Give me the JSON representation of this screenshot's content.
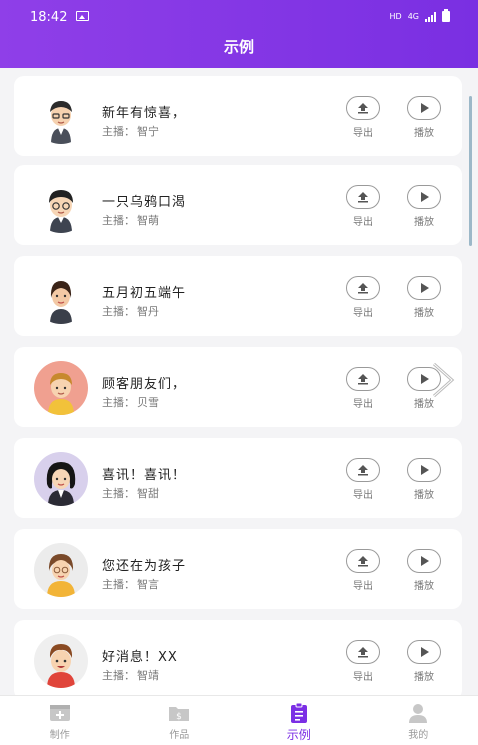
{
  "status_bar": {
    "time": "18:42",
    "network": "HD",
    "signal": "4G"
  },
  "header": {
    "title": "示例"
  },
  "actions": {
    "export_label": "导出",
    "play_label": "播放"
  },
  "host_prefix": "主播：",
  "items": [
    {
      "title": "新年有惊喜，",
      "host": "智宁"
    },
    {
      "title": "一只乌鸦口渴",
      "host": "智萌"
    },
    {
      "title": "五月初五端午",
      "host": "智丹"
    },
    {
      "title": "顾客朋友们，",
      "host": "贝雪"
    },
    {
      "title": "喜讯！喜讯！",
      "host": "智甜"
    },
    {
      "title": "您还在为孩子",
      "host": "智言"
    },
    {
      "title": "好消息！XX",
      "host": "智靖"
    }
  ],
  "nav": {
    "create": "制作",
    "works": "作品",
    "examples": "示例",
    "mine": "我的"
  },
  "colors": {
    "accent": "#7b2ee5",
    "header_start": "#8f3fe8",
    "header_end": "#7a2fe2"
  }
}
